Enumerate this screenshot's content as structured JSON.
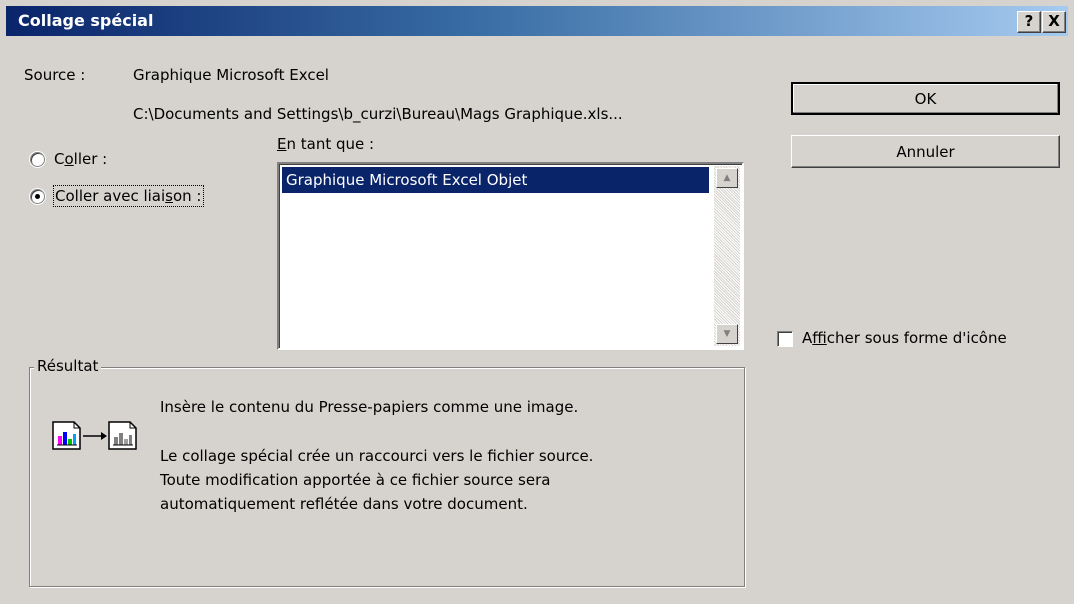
{
  "window": {
    "title": "Collage spécial",
    "help_label": "?",
    "close_label": "X"
  },
  "source": {
    "label": "Source :",
    "name": "Graphique Microsoft Excel",
    "path": "C:\\Documents and Settings\\b_curzi\\Bureau\\Mags Graphique.xls..."
  },
  "options": {
    "paste": {
      "before": "C",
      "accel": "o",
      "after": "ller :",
      "selected": false
    },
    "paste_link": {
      "before": "Coller avec liai",
      "accel": "s",
      "after": "on :",
      "selected": true
    }
  },
  "as": {
    "label_accel": "E",
    "label_rest": "n tant que :",
    "items": [
      "Graphique Microsoft Excel Objet"
    ],
    "selected_index": 0
  },
  "buttons": {
    "ok": "OK",
    "cancel": "Annuler"
  },
  "display_icon": {
    "before": "A",
    "accel": "f",
    "after": "ficher sous forme d'icône",
    "checked": false
  },
  "result": {
    "group_label": "Résultat",
    "line1": "Insère le contenu du Presse-papiers comme une image.",
    "line2": "Le collage spécial crée un raccourci vers le fichier source.",
    "line3": "Toute modification apportée à ce fichier source sera",
    "line4": "automatiquement reflétée dans votre document."
  },
  "icons": {
    "result_icon": "paste-link-chart-icon",
    "scroll_up": "scroll-up-arrow-icon",
    "scroll_down": "scroll-down-arrow-icon"
  },
  "colors": {
    "title_start": "#0a246a",
    "title_end": "#a6caf0",
    "face": "#d6d3ce",
    "selection": "#0a246a"
  }
}
